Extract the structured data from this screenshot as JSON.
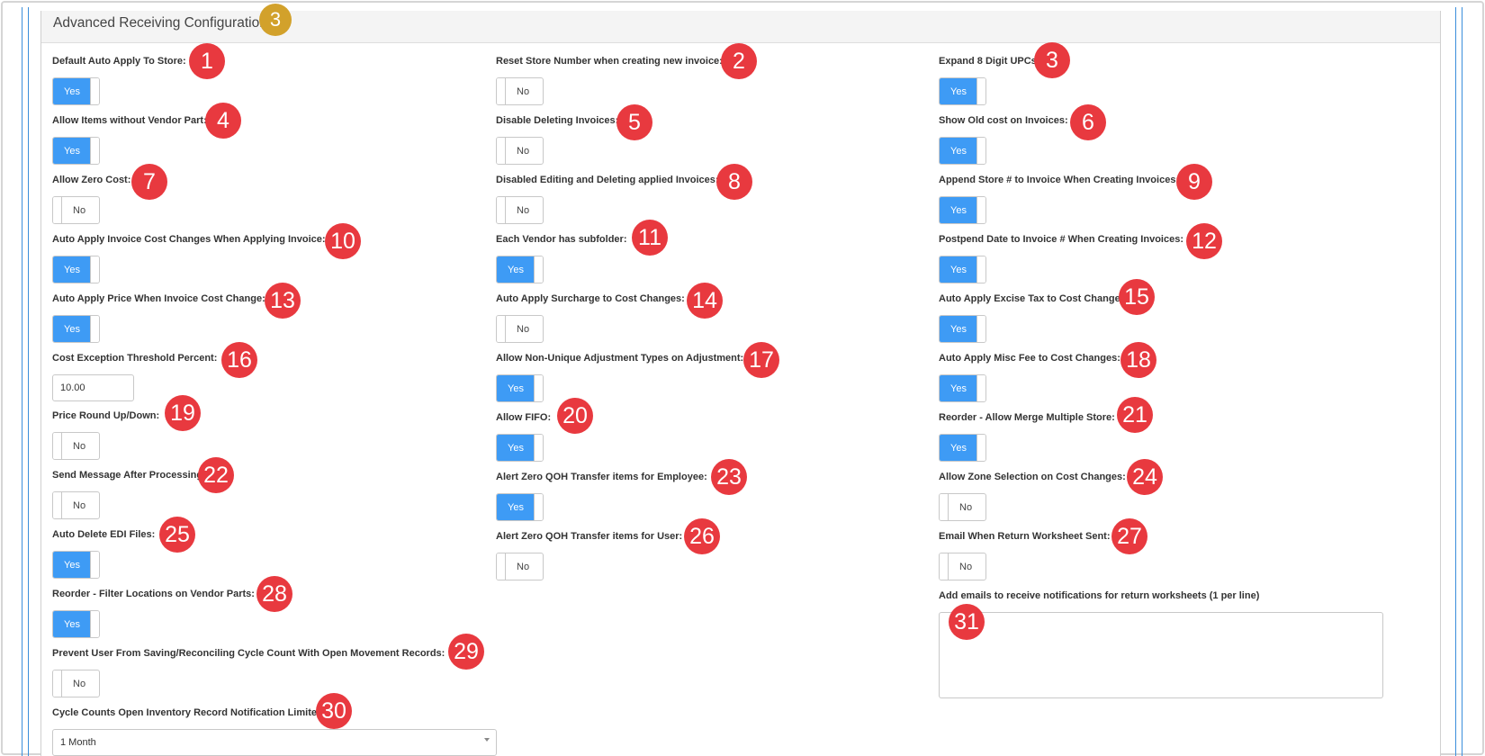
{
  "panel": {
    "title": "Advanced Receiving Configuration",
    "badge": "3"
  },
  "fields": [
    {
      "label": "Default Auto Apply To Store:",
      "type": "toggle",
      "value": "Yes",
      "badge": "1"
    },
    {
      "label": "Reset Store Number when creating new invoice:",
      "type": "toggle",
      "value": "No",
      "badge": "2"
    },
    {
      "label": "Expand 8 Digit UPCs:",
      "type": "toggle",
      "value": "Yes",
      "badge": "3"
    },
    {
      "label": "Allow Items without Vendor Part:",
      "type": "toggle",
      "value": "Yes",
      "badge": "4"
    },
    {
      "label": "Disable Deleting Invoices:",
      "type": "toggle",
      "value": "No",
      "badge": "5"
    },
    {
      "label": "Show Old cost on Invoices:",
      "type": "toggle",
      "value": "Yes",
      "badge": "6"
    },
    {
      "label": "Allow Zero Cost:",
      "type": "toggle",
      "value": "No",
      "badge": "7"
    },
    {
      "label": "Disabled Editing and Deleting applied Invoices:",
      "type": "toggle",
      "value": "No",
      "badge": "8"
    },
    {
      "label": "Append Store # to Invoice When Creating Invoices:",
      "type": "toggle",
      "value": "Yes",
      "badge": "9"
    },
    {
      "label": "Auto Apply Invoice Cost Changes When Applying Invoice:",
      "type": "toggle",
      "value": "Yes",
      "badge": "10"
    },
    {
      "label": "Each Vendor has subfolder:",
      "type": "toggle",
      "value": "Yes",
      "badge": "11"
    },
    {
      "label": "Postpend Date to Invoice # When Creating Invoices:",
      "type": "toggle",
      "value": "Yes",
      "badge": "12"
    },
    {
      "label": "Auto Apply Price When Invoice Cost Change:",
      "type": "toggle",
      "value": "Yes",
      "badge": "13"
    },
    {
      "label": "Auto Apply  Surcharge to Cost Changes:",
      "type": "toggle",
      "value": "No",
      "badge": "14"
    },
    {
      "label": "Auto Apply Excise Tax to Cost Changes:",
      "type": "toggle",
      "value": "Yes",
      "badge": "15"
    },
    {
      "label": "Cost Exception Threshold Percent:",
      "type": "number",
      "value": "10.00",
      "badge": "16"
    },
    {
      "label": "Allow Non-Unique Adjustment Types on Adjustment:",
      "type": "toggle",
      "value": "Yes",
      "badge": "17"
    },
    {
      "label": "Auto Apply Misc Fee to Cost Changes:",
      "type": "toggle",
      "value": "Yes",
      "badge": "18"
    },
    {
      "label": "Price Round Up/Down:",
      "type": "toggle",
      "value": "No",
      "badge": "19"
    },
    {
      "label": "Allow FIFO:",
      "type": "toggle",
      "value": "Yes",
      "badge": "20"
    },
    {
      "label": "Reorder - Allow Merge Multiple Store:",
      "type": "toggle",
      "value": "Yes",
      "badge": "21"
    },
    {
      "label": "Send Message After Processing:",
      "type": "toggle",
      "value": "No",
      "badge": "22"
    },
    {
      "label": "Alert Zero QOH Transfer items for Employee:",
      "type": "toggle",
      "value": "Yes",
      "badge": "23"
    },
    {
      "label": "Allow Zone Selection on Cost Changes:",
      "type": "toggle",
      "value": "No",
      "badge": "24"
    },
    {
      "label": "Auto Delete EDI Files:",
      "type": "toggle",
      "value": "Yes",
      "badge": "25"
    },
    {
      "label": "Alert Zero QOH Transfer items for User:",
      "type": "toggle",
      "value": "No",
      "badge": "26"
    },
    {
      "label": "Email When Return Worksheet Sent:",
      "type": "toggle",
      "value": "No",
      "badge": "27"
    },
    {
      "label": "Reorder - Filter Locations on Vendor Parts:",
      "type": "toggle",
      "value": "Yes",
      "badge": "28"
    },
    {
      "label": "Add emails to receive notifications for return worksheets (1 per line)",
      "type": "textarea",
      "value": "",
      "badge": "31"
    },
    {
      "label": "Prevent User From Saving/Reconciling Cycle Count With Open Movement Records:",
      "type": "toggle",
      "value": "No",
      "badge": "29"
    },
    {
      "label": "Cycle Counts Open Inventory Record Notification Limiter:",
      "type": "select",
      "value": "1 Month",
      "badge": "30"
    }
  ]
}
